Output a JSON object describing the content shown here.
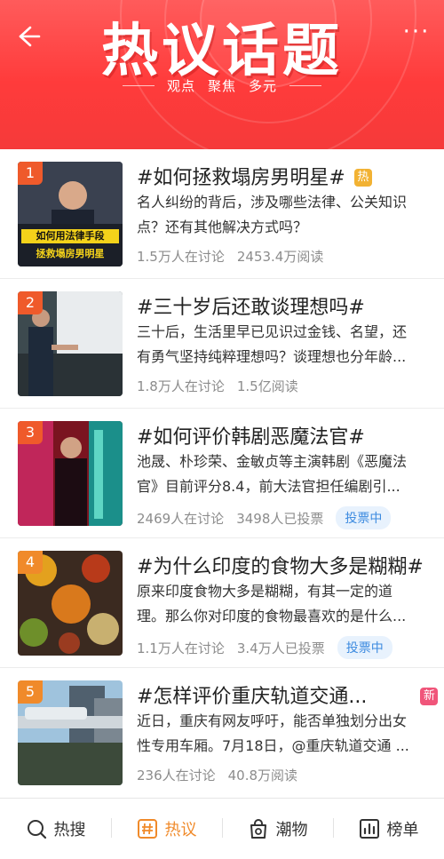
{
  "header": {
    "title": "热议话题",
    "subtitle": [
      "观点",
      "聚焦",
      "多元"
    ]
  },
  "topics": [
    {
      "rank": "1",
      "title": "#如何拯救塌房男明星#",
      "tag": "热",
      "desc": "名人纠纷的背后，涉及哪些法律、公关知识点？还有其他解决方式吗？",
      "discuss": "1.5万人在讨论",
      "stat": "2453.4万阅读",
      "thumb_text": [
        "如何用法律手段",
        "拯救塌房男明星"
      ]
    },
    {
      "rank": "2",
      "title": "#三十岁后还敢谈理想吗#",
      "desc": "三十后，生活里早已见识过金钱、名望，还有勇气坚持纯粹理想吗？谈理想也分年龄...",
      "discuss": "1.8万人在讨论",
      "stat": "1.5亿阅读"
    },
    {
      "rank": "3",
      "title": "#如何评价韩剧恶魔法官#",
      "desc": "池晟、朴珍荣、金敏贞等主演韩剧《恶魔法官》目前评分8.4，前大法官担任编剧引...",
      "discuss": "2469人在讨论",
      "stat": "3498人已投票",
      "vote": "投票中"
    },
    {
      "rank": "4",
      "title": "#为什么印度的食物大多是糊糊#",
      "desc": "原来印度食物大多是糊糊，有其一定的道理。那么你对印度的食物最喜欢的是什么...",
      "discuss": "1.1万人在讨论",
      "stat": "3.4万人已投票",
      "vote": "投票中"
    },
    {
      "rank": "5",
      "title": "#怎样评价重庆轨道交通...",
      "tag": "新",
      "desc": "近日，重庆有网友呼吁，能否单独划分出女性专用车厢。7月18日，@重庆轨道交通 ...",
      "discuss": "236人在讨论",
      "stat": "40.8万阅读"
    }
  ],
  "tabbar": {
    "items": [
      {
        "label": "热搜",
        "icon": "search-icon"
      },
      {
        "label": "热议",
        "icon": "hashtag-icon",
        "active": true
      },
      {
        "label": "潮物",
        "icon": "bag-icon"
      },
      {
        "label": "榜单",
        "icon": "chart-icon"
      }
    ]
  },
  "colors": {
    "header": "#ff4040",
    "accent": "#f08a2a",
    "vote_bg": "#e8f2fd",
    "vote_text": "#3d8be0"
  }
}
